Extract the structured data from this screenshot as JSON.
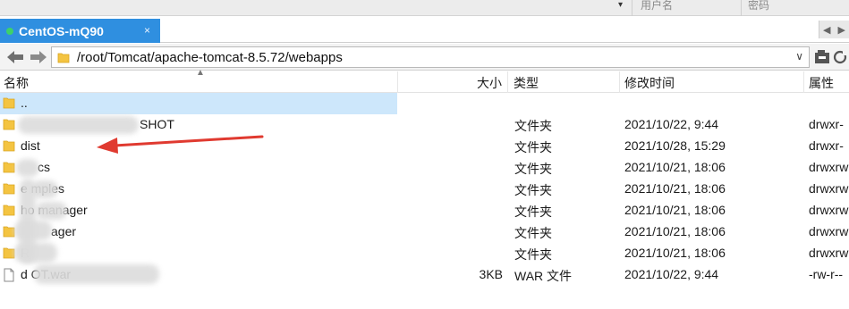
{
  "topbar": {
    "dropdown_glyph": "▾",
    "col_username": "用户名",
    "col_password": "密码"
  },
  "tab": {
    "title": "CentOS-mQ90",
    "close": "×",
    "status_color": "#3dd16b",
    "accent": "#2f8fe0"
  },
  "tabnav": {
    "prev": "◀",
    "next": "▶"
  },
  "address": {
    "path": "/root/Tomcat/apache-tomcat-8.5.72/webapps",
    "dropdown": "∨"
  },
  "columns": {
    "name": "名称",
    "size": "大小",
    "type": "类型",
    "modified": "修改时间",
    "attributes": "属性"
  },
  "rows": [
    {
      "name": "..",
      "size": "",
      "type": "",
      "modified": "",
      "attr": "",
      "icon": "folder-icon"
    },
    {
      "name": "SHOT",
      "size": "",
      "type": "文件夹",
      "modified": "2021/10/22, 9:44",
      "attr": "drwxr-",
      "icon": "folder-icon"
    },
    {
      "name": "dist",
      "size": "",
      "type": "文件夹",
      "modified": "2021/10/28, 15:29",
      "attr": "drwxr-",
      "icon": "folder-icon"
    },
    {
      "name": "cs",
      "size": "",
      "type": "文件夹",
      "modified": "2021/10/21, 18:06",
      "attr": "drwxrw",
      "icon": "folder-icon"
    },
    {
      "name": "e    mples",
      "size": "",
      "type": "文件夹",
      "modified": "2021/10/21, 18:06",
      "attr": "drwxrw",
      "icon": "folder-icon"
    },
    {
      "name": "ho    manager",
      "size": "",
      "type": "文件夹",
      "modified": "2021/10/21, 18:06",
      "attr": "drwxrw",
      "icon": "folder-icon"
    },
    {
      "name": "ager",
      "size": "",
      "type": "文件夹",
      "modified": "2021/10/21, 18:06",
      "attr": "drwxrw",
      "icon": "folder-icon"
    },
    {
      "name": "R",
      "size": "",
      "type": "文件夹",
      "modified": "2021/10/21, 18:06",
      "attr": "drwxrw",
      "icon": "folder-icon"
    },
    {
      "name": "d                         OT.war",
      "size": "3KB",
      "type": "WAR 文件",
      "modified": "2021/10/22, 9:44",
      "attr": "-rw-r--",
      "icon": "file-icon"
    }
  ],
  "annotation": {
    "arrow_color": "#e03a30"
  }
}
